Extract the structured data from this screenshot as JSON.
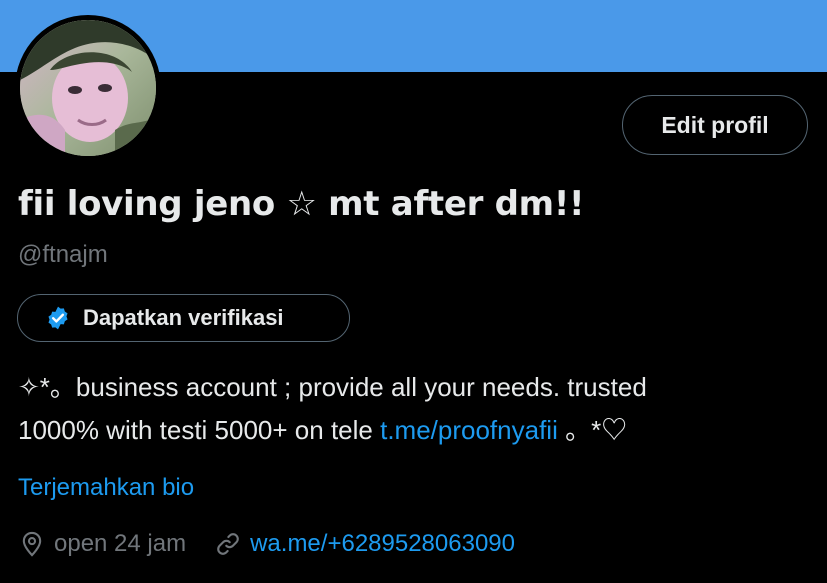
{
  "profile": {
    "display_name": "fii loving jeno ☆ mt after dm!!",
    "handle": "@ftnajm",
    "edit_button_label": "Edit profil",
    "verify_button_label": "Dapatkan verifikasi",
    "bio": {
      "line1": "✧*。business account ; provide all your needs. trusted",
      "line2_prefix": "1000% with testi 5000+ on tele ",
      "link": "t.me/proofnyafii",
      "line2_suffix": " 。*♡"
    },
    "translate_label": "Terjemahkan bio",
    "location": "open 24 jam",
    "website": "wa.me/+6289528063090"
  },
  "icons": {
    "verify": "verified-badge-icon",
    "location": "location-pin-icon",
    "website": "link-icon"
  },
  "colors": {
    "banner": "#4a99e9",
    "background": "#000000",
    "text_primary": "#e7e9ea",
    "text_secondary": "#71767b",
    "link": "#1d9bf0",
    "border": "#536471"
  }
}
